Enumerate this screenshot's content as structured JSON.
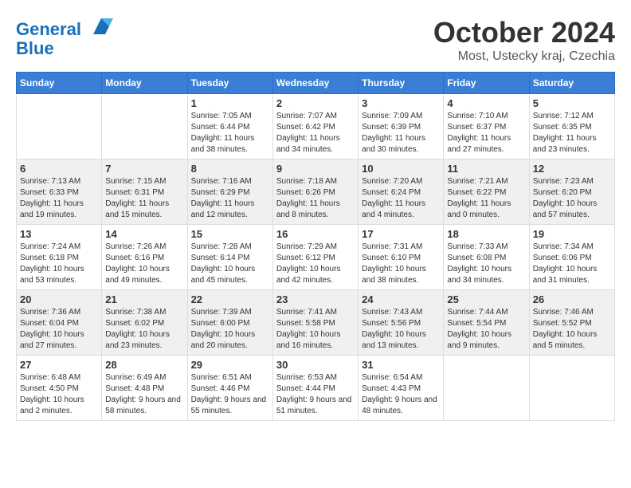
{
  "header": {
    "logo_line1": "General",
    "logo_line2": "Blue",
    "month": "October 2024",
    "location": "Most, Ustecky kraj, Czechia"
  },
  "days_of_week": [
    "Sunday",
    "Monday",
    "Tuesday",
    "Wednesday",
    "Thursday",
    "Friday",
    "Saturday"
  ],
  "weeks": [
    [
      {
        "day": "",
        "info": ""
      },
      {
        "day": "",
        "info": ""
      },
      {
        "day": "1",
        "info": "Sunrise: 7:05 AM\nSunset: 6:44 PM\nDaylight: 11 hours and 38 minutes."
      },
      {
        "day": "2",
        "info": "Sunrise: 7:07 AM\nSunset: 6:42 PM\nDaylight: 11 hours and 34 minutes."
      },
      {
        "day": "3",
        "info": "Sunrise: 7:09 AM\nSunset: 6:39 PM\nDaylight: 11 hours and 30 minutes."
      },
      {
        "day": "4",
        "info": "Sunrise: 7:10 AM\nSunset: 6:37 PM\nDaylight: 11 hours and 27 minutes."
      },
      {
        "day": "5",
        "info": "Sunrise: 7:12 AM\nSunset: 6:35 PM\nDaylight: 11 hours and 23 minutes."
      }
    ],
    [
      {
        "day": "6",
        "info": "Sunrise: 7:13 AM\nSunset: 6:33 PM\nDaylight: 11 hours and 19 minutes."
      },
      {
        "day": "7",
        "info": "Sunrise: 7:15 AM\nSunset: 6:31 PM\nDaylight: 11 hours and 15 minutes."
      },
      {
        "day": "8",
        "info": "Sunrise: 7:16 AM\nSunset: 6:29 PM\nDaylight: 11 hours and 12 minutes."
      },
      {
        "day": "9",
        "info": "Sunrise: 7:18 AM\nSunset: 6:26 PM\nDaylight: 11 hours and 8 minutes."
      },
      {
        "day": "10",
        "info": "Sunrise: 7:20 AM\nSunset: 6:24 PM\nDaylight: 11 hours and 4 minutes."
      },
      {
        "day": "11",
        "info": "Sunrise: 7:21 AM\nSunset: 6:22 PM\nDaylight: 11 hours and 0 minutes."
      },
      {
        "day": "12",
        "info": "Sunrise: 7:23 AM\nSunset: 6:20 PM\nDaylight: 10 hours and 57 minutes."
      }
    ],
    [
      {
        "day": "13",
        "info": "Sunrise: 7:24 AM\nSunset: 6:18 PM\nDaylight: 10 hours and 53 minutes."
      },
      {
        "day": "14",
        "info": "Sunrise: 7:26 AM\nSunset: 6:16 PM\nDaylight: 10 hours and 49 minutes."
      },
      {
        "day": "15",
        "info": "Sunrise: 7:28 AM\nSunset: 6:14 PM\nDaylight: 10 hours and 45 minutes."
      },
      {
        "day": "16",
        "info": "Sunrise: 7:29 AM\nSunset: 6:12 PM\nDaylight: 10 hours and 42 minutes."
      },
      {
        "day": "17",
        "info": "Sunrise: 7:31 AM\nSunset: 6:10 PM\nDaylight: 10 hours and 38 minutes."
      },
      {
        "day": "18",
        "info": "Sunrise: 7:33 AM\nSunset: 6:08 PM\nDaylight: 10 hours and 34 minutes."
      },
      {
        "day": "19",
        "info": "Sunrise: 7:34 AM\nSunset: 6:06 PM\nDaylight: 10 hours and 31 minutes."
      }
    ],
    [
      {
        "day": "20",
        "info": "Sunrise: 7:36 AM\nSunset: 6:04 PM\nDaylight: 10 hours and 27 minutes."
      },
      {
        "day": "21",
        "info": "Sunrise: 7:38 AM\nSunset: 6:02 PM\nDaylight: 10 hours and 23 minutes."
      },
      {
        "day": "22",
        "info": "Sunrise: 7:39 AM\nSunset: 6:00 PM\nDaylight: 10 hours and 20 minutes."
      },
      {
        "day": "23",
        "info": "Sunrise: 7:41 AM\nSunset: 5:58 PM\nDaylight: 10 hours and 16 minutes."
      },
      {
        "day": "24",
        "info": "Sunrise: 7:43 AM\nSunset: 5:56 PM\nDaylight: 10 hours and 13 minutes."
      },
      {
        "day": "25",
        "info": "Sunrise: 7:44 AM\nSunset: 5:54 PM\nDaylight: 10 hours and 9 minutes."
      },
      {
        "day": "26",
        "info": "Sunrise: 7:46 AM\nSunset: 5:52 PM\nDaylight: 10 hours and 5 minutes."
      }
    ],
    [
      {
        "day": "27",
        "info": "Sunrise: 6:48 AM\nSunset: 4:50 PM\nDaylight: 10 hours and 2 minutes."
      },
      {
        "day": "28",
        "info": "Sunrise: 6:49 AM\nSunset: 4:48 PM\nDaylight: 9 hours and 58 minutes."
      },
      {
        "day": "29",
        "info": "Sunrise: 6:51 AM\nSunset: 4:46 PM\nDaylight: 9 hours and 55 minutes."
      },
      {
        "day": "30",
        "info": "Sunrise: 6:53 AM\nSunset: 4:44 PM\nDaylight: 9 hours and 51 minutes."
      },
      {
        "day": "31",
        "info": "Sunrise: 6:54 AM\nSunset: 4:43 PM\nDaylight: 9 hours and 48 minutes."
      },
      {
        "day": "",
        "info": ""
      },
      {
        "day": "",
        "info": ""
      }
    ]
  ]
}
